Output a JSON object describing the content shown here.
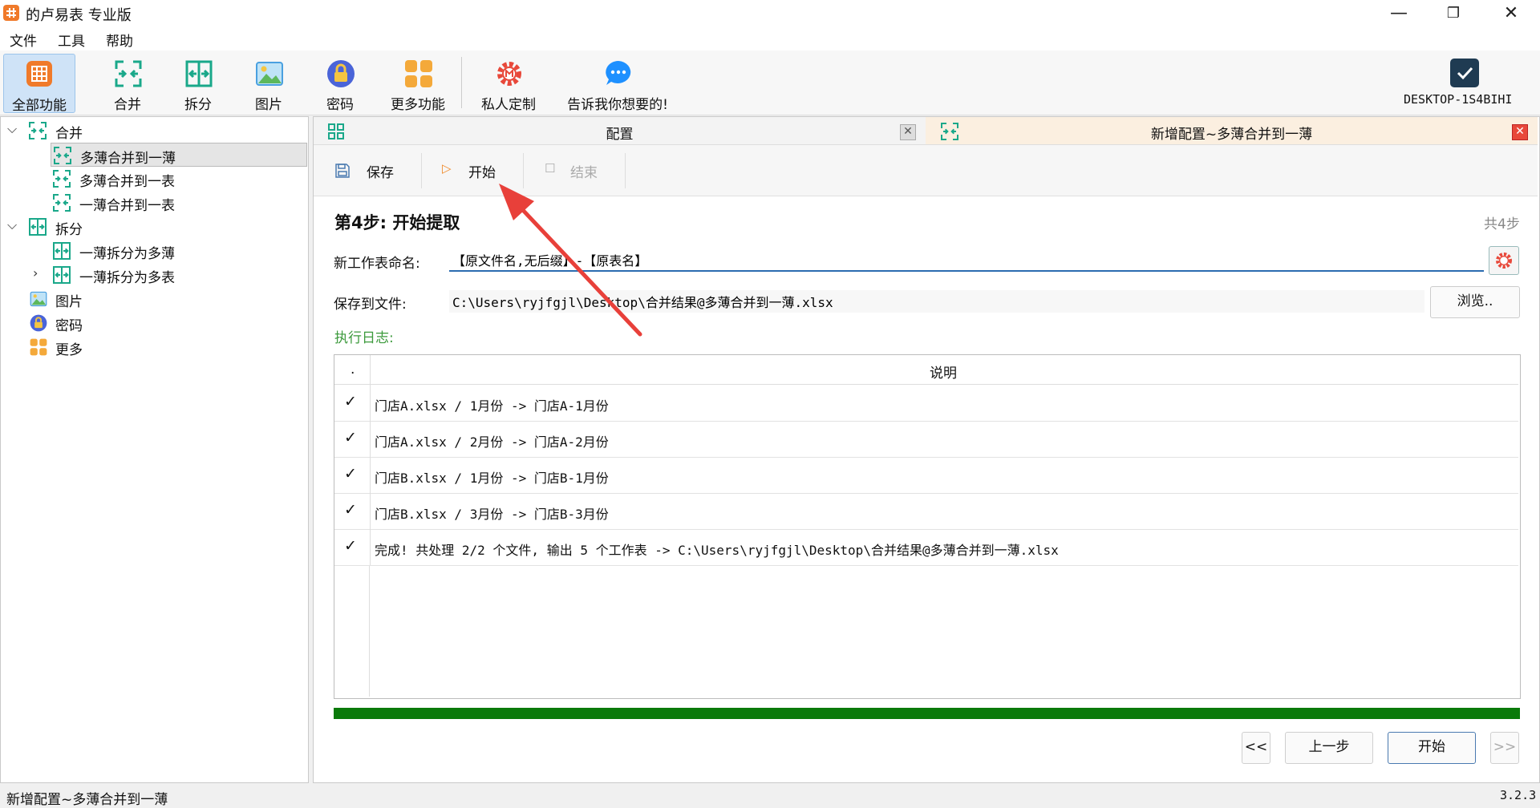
{
  "window": {
    "title": "的卢易表 专业版",
    "minimize": "—",
    "maximize": "❐",
    "close": "✕"
  },
  "menu": [
    "文件",
    "工具",
    "帮助"
  ],
  "toolbar": {
    "items": [
      {
        "label": "全部功能",
        "icon": "all-functions-icon",
        "color": "#f07a2a"
      },
      {
        "label": "合并",
        "icon": "merge-icon",
        "color": "#1aa88a"
      },
      {
        "label": "拆分",
        "icon": "split-icon",
        "color": "#1aa88a"
      },
      {
        "label": "图片",
        "icon": "image-icon",
        "color": "#4aa0e0"
      },
      {
        "label": "密码",
        "icon": "lock-icon",
        "color": "#4a64d8"
      },
      {
        "label": "更多功能",
        "icon": "more-icon",
        "color": "#f4a93a"
      },
      {
        "label": "私人定制",
        "icon": "custom-gear-icon",
        "color": "#e8483a"
      },
      {
        "label": "告诉我你想要的!",
        "icon": "chat-icon",
        "color": "#1e90ff"
      }
    ],
    "user": "DESKTOP-1S4BIHI"
  },
  "tree": [
    {
      "label": "合并",
      "level": 0,
      "expanded": true
    },
    {
      "label": "多薄合并到一薄",
      "level": 1,
      "selected": true
    },
    {
      "label": "多薄合并到一表",
      "level": 1
    },
    {
      "label": "一薄合并到一表",
      "level": 1
    },
    {
      "label": "拆分",
      "level": 0,
      "expanded": true
    },
    {
      "label": "一薄拆分为多薄",
      "level": 1
    },
    {
      "label": "一薄拆分为多表",
      "level": 1
    },
    {
      "label": "图片",
      "level": 0
    },
    {
      "label": "密码",
      "level": 0
    },
    {
      "label": "更多",
      "level": 0
    }
  ],
  "tabs": [
    {
      "title": "配置",
      "close": "✕"
    },
    {
      "title": "新增配置~多薄合并到一薄",
      "close": "✕"
    }
  ],
  "actions": {
    "save": "保存",
    "start": "开始",
    "end": "结束"
  },
  "step": {
    "title": "第4步: 开始提取",
    "count": "共4步"
  },
  "form": {
    "name_label": "新工作表命名:",
    "name_value": "【原文件名,无后缀】-【原表名】",
    "file_label": "保存到文件:",
    "file_value": "C:\\Users\\ryjfgjl\\Desktop\\合并结果@多薄合并到一薄.xlsx",
    "browse": "浏览.."
  },
  "log": {
    "label": "执行日志:",
    "columns": [
      ".",
      "说明"
    ],
    "rows": [
      {
        "mark": "✓",
        "text": "门店A.xlsx / 1月份 -> 门店A-1月份"
      },
      {
        "mark": "✓",
        "text": "门店A.xlsx / 2月份 -> 门店A-2月份"
      },
      {
        "mark": "✓",
        "text": "门店B.xlsx / 1月份 -> 门店B-1月份"
      },
      {
        "mark": "✓",
        "text": "门店B.xlsx / 3月份 -> 门店B-3月份"
      },
      {
        "mark": "✓",
        "text": "完成! 共处理 2/2 个文件, 输出 5 个工作表 -> C:\\Users\\ryjfgjl\\Desktop\\合并结果@多薄合并到一薄.xlsx"
      }
    ]
  },
  "progress": 100,
  "nav": {
    "first": "<<",
    "prev": "上一步",
    "start": "开始",
    "last": ">>"
  },
  "status": {
    "left": "新增配置~多薄合并到一薄",
    "version": "3.2.3"
  }
}
